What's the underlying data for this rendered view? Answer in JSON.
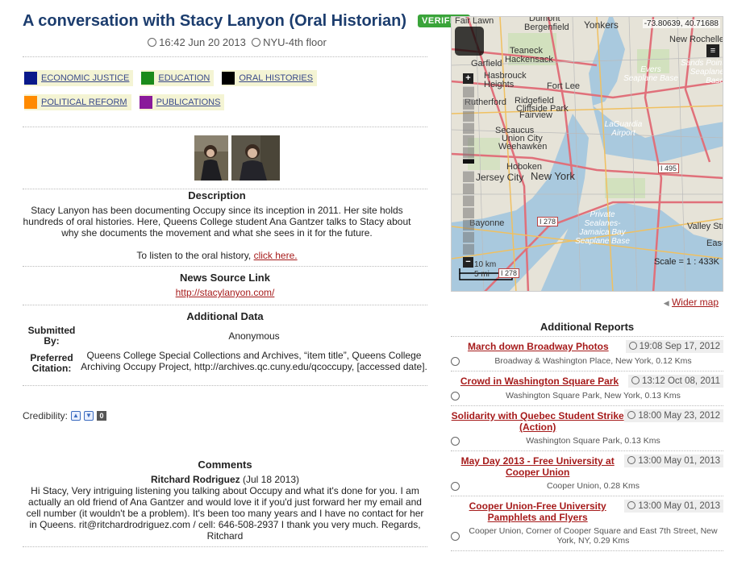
{
  "report": {
    "title": "A conversation with Stacy Lanyon (Oral Historian)",
    "badge": "VERIFIED",
    "datetime": "16:42 Jun 20 2013",
    "location": "NYU-4th floor"
  },
  "categories": [
    {
      "label": "ECONOMIC JUSTICE",
      "color": "#0a1a8a"
    },
    {
      "label": "EDUCATION",
      "color": "#1a8a1a"
    },
    {
      "label": "ORAL HISTORIES",
      "color": "#000000"
    },
    {
      "label": "POLITICAL REFORM",
      "color": "#ff8a00"
    },
    {
      "label": "PUBLICATIONS",
      "color": "#8a1a9a"
    }
  ],
  "description": {
    "heading": "Description",
    "body": "Stacy Lanyon has been documenting Occupy since its inception in 2011. Her site holds hundreds of oral histories. Here, Queens College student Ana Gantzer talks to Stacy about why she documents the movement and what she sees in it for the future.",
    "listen_prefix": "To listen to the oral history,",
    "listen_link": "click here."
  },
  "news_source": {
    "heading": "News Source Link",
    "url": "http://stacylanyon.com/"
  },
  "additional_data": {
    "heading": "Additional Data",
    "submitted_by_label": "Submitted By:",
    "submitted_by": "Anonymous",
    "citation_label": "Preferred Citation:",
    "citation": "Queens College Special Collections and Archives, “item title”, Queens College Archiving Occupy Project, http://archives.qc.cuny.edu/qcoccupy, [accessed date]."
  },
  "credibility": {
    "label": "Credibility:",
    "up": "▲",
    "down": "▼",
    "count": "0"
  },
  "comments": {
    "heading": "Comments",
    "items": [
      {
        "author": "Ritchard Rodriguez",
        "date": "(Jul 18 2013)",
        "text": "Hi Stacy, Very intriguing listening you talking about Occupy and what it's done for you. I am actually an old friend of Ana Gantzer and would love it if you'd just forward her my email and cell number (it wouldn't be a problem). It's been too many years and I have no contact for her in Queens. rit@ritchardrodriguez.com / cell: 646-508-2937 I thank you very much. Regards, Ritchard"
      }
    ]
  },
  "map": {
    "coords": "-73.80639, 40.71688",
    "scale": "Scale = 1 : 433K",
    "scale_km": "10 km",
    "scale_mi": "5 mi",
    "labels": [
      "Fair Lawn",
      "Dumont",
      "Bergenfield",
      "Yonkers",
      "New Rochelle",
      "Teaneck",
      "Hackensack",
      "Garfield",
      "Hasbrouck Heights",
      "Fort Lee",
      "Evers Seaplane Base",
      "Sands Point Seaplane Base",
      "Rutherford",
      "Ridgefield",
      "Cliffside Park",
      "Fairview",
      "LaGuardia Airport",
      "Secaucus",
      "Union City",
      "Weehawken",
      "Hoboken",
      "Jersey City",
      "New York",
      "I 495",
      "Bayonne",
      "I 278",
      "Private Sealanes-Jamaica Bay Seaplane Base",
      "Valley Stream",
      "East",
      "I 278"
    ],
    "wider_label": "Wider map"
  },
  "additional_reports": {
    "heading": "Additional Reports",
    "items": [
      {
        "title": "March down Broadway Photos",
        "date": "19:08 Sep 17, 2012",
        "location": "Broadway & Washington Place, New York, 0.12 Kms"
      },
      {
        "title": "Crowd in Washington Square Park",
        "date": "13:12 Oct 08, 2011",
        "location": "Washington Square Park, New York, 0.13 Kms"
      },
      {
        "title": "Solidarity with Quebec Student Strike (Action)",
        "date": "18:00 May 23, 2012",
        "location": "Washington Square Park, 0.13 Kms"
      },
      {
        "title": "May Day 2013 - Free University at Cooper Union",
        "date": "13:00 May 01, 2013",
        "location": "Cooper Union, 0.28 Kms"
      },
      {
        "title": "Cooper Union-Free University Pamphlets and Flyers",
        "date": "13:00 May 01, 2013",
        "location": "Cooper Union, Corner of Cooper Square and East 7th Street, New York, NY, 0.29 Kms"
      }
    ]
  }
}
